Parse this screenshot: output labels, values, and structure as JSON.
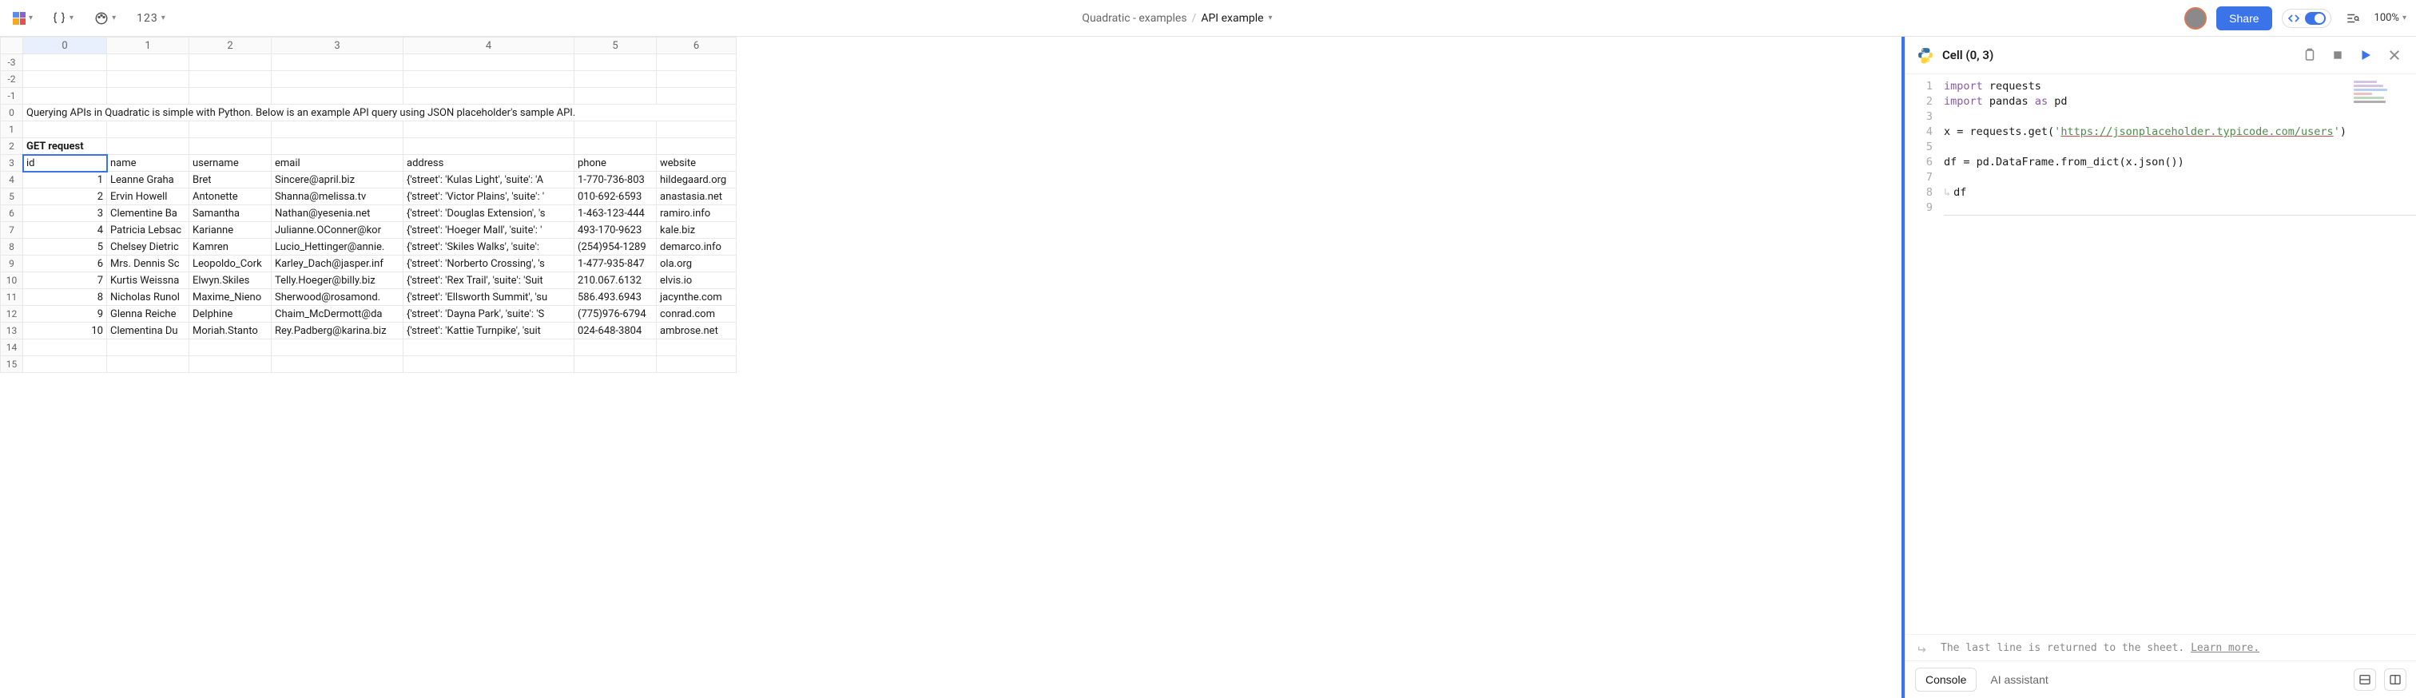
{
  "toolbar": {
    "format_numeric_label": "123",
    "breadcrumb_workspace": "Quadratic - examples",
    "breadcrumb_file": "API example",
    "share_label": "Share",
    "zoom_label": "100%"
  },
  "sheet": {
    "columns": [
      "0",
      "1",
      "2",
      "3",
      "4",
      "5",
      "6"
    ],
    "row_headers": [
      "-3",
      "-2",
      "-1",
      "0",
      "1",
      "2",
      "3",
      "4",
      "5",
      "6",
      "7",
      "8",
      "9",
      "10",
      "11",
      "12",
      "13",
      "14",
      "15"
    ],
    "selected_cell": {
      "row_idx": 6,
      "col_idx": 0
    },
    "rows": [
      [],
      [],
      [],
      [
        {
          "v": "Querying APIs in Quadratic is simple with Python. Below is an example API query using JSON placeholder's sample API.",
          "span": 7
        }
      ],
      [],
      [
        {
          "v": "GET request",
          "bold": true
        }
      ],
      [
        {
          "v": "id"
        },
        {
          "v": "name"
        },
        {
          "v": "username"
        },
        {
          "v": "email"
        },
        {
          "v": "address"
        },
        {
          "v": "phone"
        },
        {
          "v": "website"
        }
      ],
      [
        {
          "v": "1",
          "num": true
        },
        {
          "v": "Leanne Graha"
        },
        {
          "v": "Bret"
        },
        {
          "v": "Sincere@april.biz"
        },
        {
          "v": "{'street': 'Kulas Light', 'suite': 'A"
        },
        {
          "v": "1-770-736-803"
        },
        {
          "v": "hildegaard.org"
        }
      ],
      [
        {
          "v": "2",
          "num": true
        },
        {
          "v": "Ervin Howell"
        },
        {
          "v": "Antonette"
        },
        {
          "v": "Shanna@melissa.tv"
        },
        {
          "v": "{'street': 'Victor Plains', 'suite': '"
        },
        {
          "v": "010-692-6593"
        },
        {
          "v": "anastasia.net"
        }
      ],
      [
        {
          "v": "3",
          "num": true
        },
        {
          "v": "Clementine Ba"
        },
        {
          "v": "Samantha"
        },
        {
          "v": "Nathan@yesenia.net"
        },
        {
          "v": "{'street': 'Douglas Extension', 's"
        },
        {
          "v": "1-463-123-444"
        },
        {
          "v": "ramiro.info"
        }
      ],
      [
        {
          "v": "4",
          "num": true
        },
        {
          "v": "Patricia Lebsac"
        },
        {
          "v": "Karianne"
        },
        {
          "v": "Julianne.OConner@kor"
        },
        {
          "v": "{'street': 'Hoeger Mall', 'suite': '"
        },
        {
          "v": "493-170-9623"
        },
        {
          "v": "kale.biz"
        }
      ],
      [
        {
          "v": "5",
          "num": true
        },
        {
          "v": "Chelsey Dietric"
        },
        {
          "v": "Kamren"
        },
        {
          "v": "Lucio_Hettinger@annie."
        },
        {
          "v": "{'street': 'Skiles Walks', 'suite': "
        },
        {
          "v": "(254)954-1289"
        },
        {
          "v": "demarco.info"
        }
      ],
      [
        {
          "v": "6",
          "num": true
        },
        {
          "v": "Mrs. Dennis Sc"
        },
        {
          "v": "Leopoldo_Cork"
        },
        {
          "v": "Karley_Dach@jasper.inf"
        },
        {
          "v": "{'street': 'Norberto Crossing', 's"
        },
        {
          "v": "1-477-935-847"
        },
        {
          "v": "ola.org"
        }
      ],
      [
        {
          "v": "7",
          "num": true
        },
        {
          "v": "Kurtis Weissna"
        },
        {
          "v": "Elwyn.Skiles"
        },
        {
          "v": "Telly.Hoeger@billy.biz"
        },
        {
          "v": "{'street': 'Rex Trail', 'suite': 'Suit"
        },
        {
          "v": "210.067.6132"
        },
        {
          "v": "elvis.io"
        }
      ],
      [
        {
          "v": "8",
          "num": true
        },
        {
          "v": "Nicholas Runol"
        },
        {
          "v": "Maxime_Nieno"
        },
        {
          "v": "Sherwood@rosamond."
        },
        {
          "v": "{'street': 'Ellsworth Summit', 'su"
        },
        {
          "v": "586.493.6943"
        },
        {
          "v": "jacynthe.com"
        }
      ],
      [
        {
          "v": "9",
          "num": true
        },
        {
          "v": "Glenna Reiche"
        },
        {
          "v": "Delphine"
        },
        {
          "v": "Chaim_McDermott@da"
        },
        {
          "v": "{'street': 'Dayna Park', 'suite': 'S"
        },
        {
          "v": "(775)976-6794"
        },
        {
          "v": "conrad.com"
        }
      ],
      [
        {
          "v": "10",
          "num": true
        },
        {
          "v": "Clementina Du"
        },
        {
          "v": "Moriah.Stanto"
        },
        {
          "v": "Rey.Padberg@karina.biz"
        },
        {
          "v": "{'street': 'Kattie Turnpike', 'suit"
        },
        {
          "v": "024-648-3804"
        },
        {
          "v": "ambrose.net"
        }
      ],
      [],
      []
    ]
  },
  "code": {
    "title": "Cell (0, 3)",
    "lines": [
      {
        "n": "1",
        "seg": [
          {
            "t": "import ",
            "c": "kw"
          },
          {
            "t": "requests"
          }
        ]
      },
      {
        "n": "2",
        "seg": [
          {
            "t": "import ",
            "c": "kw"
          },
          {
            "t": "pandas "
          },
          {
            "t": "as ",
            "c": "kw"
          },
          {
            "t": "pd"
          }
        ]
      },
      {
        "n": "3",
        "seg": []
      },
      {
        "n": "4",
        "seg": [
          {
            "t": "x = requests.get("
          },
          {
            "t": "'",
            "c": "str"
          },
          {
            "t": "https://jsonplaceholder.typicode.com/users",
            "c": "url"
          },
          {
            "t": "'",
            "c": "str"
          },
          {
            "t": ")"
          }
        ]
      },
      {
        "n": "5",
        "seg": []
      },
      {
        "n": "6",
        "seg": [
          {
            "t": "df = pd.DataFrame.from_dict(x.json())"
          }
        ]
      },
      {
        "n": "7",
        "seg": []
      },
      {
        "n": "8",
        "seg": [
          {
            "t": "df"
          }
        ],
        "tab": true
      },
      {
        "n": "9",
        "seg": [],
        "cursor": true
      }
    ],
    "hint_text": "The last line is returned to the sheet. ",
    "hint_link": "Learn more.",
    "tabs": {
      "console": "Console",
      "ai": "AI assistant"
    },
    "minimap_colors": [
      "#8959a8",
      "#8959a8",
      "#3b73e8",
      "#c94f4f",
      "#4d8c4a",
      "#1a1a1a"
    ]
  }
}
